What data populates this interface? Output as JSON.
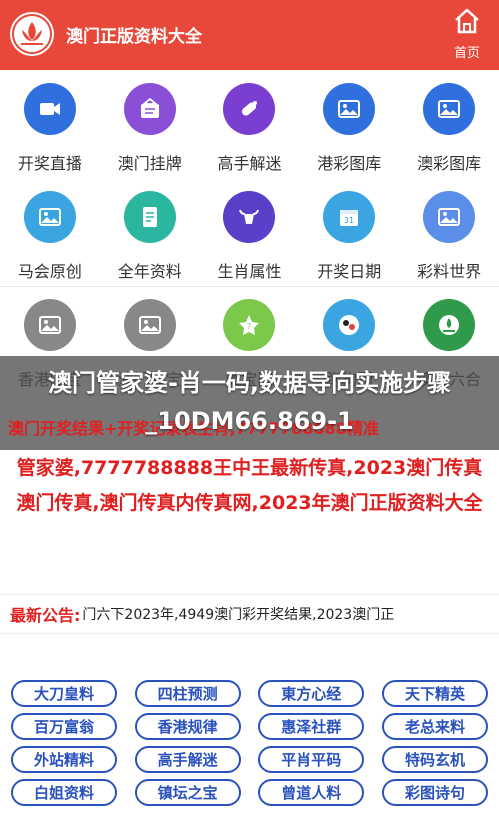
{
  "header": {
    "title": "澳门正版资料大全",
    "home_label": "首页"
  },
  "grid": {
    "rows": [
      [
        {
          "label": "开奖直播",
          "icon": "video-icon",
          "color": "#2f6fde"
        },
        {
          "label": "澳门挂牌",
          "icon": "board-icon",
          "color": "#8a4fd6"
        },
        {
          "label": "高手解迷",
          "icon": "pill-icon",
          "color": "#7a3fd0"
        },
        {
          "label": "港彩图库",
          "icon": "image-icon",
          "color": "#2f6fde"
        },
        {
          "label": "澳彩图库",
          "icon": "image-icon",
          "color": "#2f6fde"
        }
      ],
      [
        {
          "label": "马会原创",
          "icon": "image-icon",
          "color": "#3aa5e0"
        },
        {
          "label": "全年资料",
          "icon": "document-icon",
          "color": "#2bb6a0"
        },
        {
          "label": "生肖属性",
          "icon": "bull-icon",
          "color": "#5a3fc8"
        },
        {
          "label": "开奖日期",
          "icon": "calendar-icon",
          "color": "#3aa5e0"
        },
        {
          "label": "彩料世界",
          "icon": "image-icon",
          "color": "#5a8ee8"
        }
      ],
      [
        {
          "label": "香港四宝",
          "icon": "image-icon",
          "color": "#888888"
        },
        {
          "label": "澳门四宝",
          "icon": "image-icon",
          "color": "#888888"
        },
        {
          "label": "藏宝图",
          "icon": "question-icon",
          "color": "#7cc84a"
        },
        {
          "label": "跑狗图",
          "icon": "dog-icon",
          "color": "#3aa5e0"
        },
        {
          "label": "澳彩六合",
          "icon": "emblem-icon",
          "color": "#2e9a4a"
        }
      ]
    ]
  },
  "overlay": {
    "text": "澳门管家婆-肖一码,数据导向实施步骤_10DM66.869-1"
  },
  "article": {
    "line1": "澳门开奖结果+开奖记录表生肖,7777788888精准",
    "body": "管家婆,7777788888王中王最新传真,2023澳门传真澳门传真,澳门传真内传真网,2023年澳门正版资料大全"
  },
  "notice": {
    "label": "最新公告:",
    "text": "门六下2023年,4949澳门彩开奖结果,2023澳门正"
  },
  "tags": [
    [
      "大刀皇料",
      "四柱预测",
      "東方心经",
      "天下精英"
    ],
    [
      "百万富翁",
      "香港规律",
      "惠泽社群",
      "老总来料"
    ],
    [
      "外站精料",
      "高手解迷",
      "平肖平码",
      "特码玄机"
    ],
    [
      "白姐资料",
      "镇坛之宝",
      "曾道人料",
      "彩图诗句"
    ]
  ],
  "colors": {
    "brand": "#e8483a",
    "tag_border": "#2a52be",
    "article_red": "#e02020"
  }
}
